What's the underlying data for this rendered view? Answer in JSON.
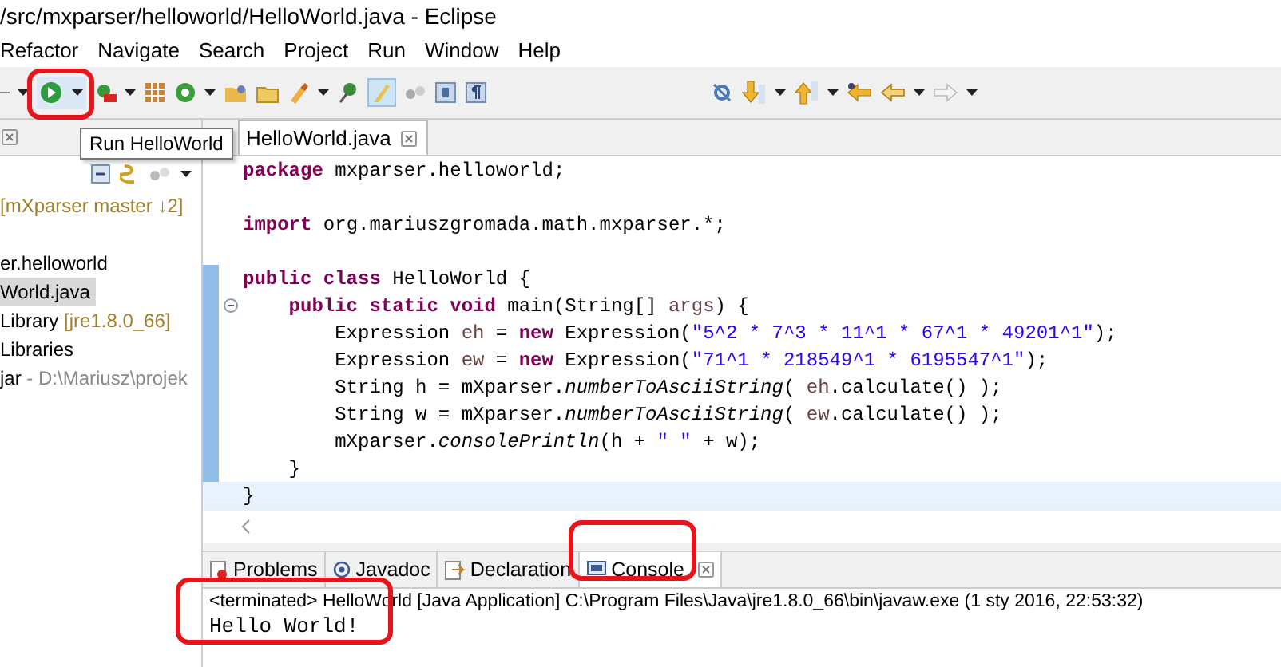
{
  "window": {
    "title": "/src/mxparser/helloworld/HelloWorld.java - Eclipse"
  },
  "menu": [
    "Refactor",
    "Navigate",
    "Search",
    "Project",
    "Run",
    "Window",
    "Help"
  ],
  "tooltip": "Run HelloWorld",
  "explorer": {
    "items": [
      {
        "label": "[mXparser master ↓2]",
        "kind": "decoration",
        "selected": false
      },
      {
        "label": "er.helloworld",
        "kind": "package",
        "selected": false
      },
      {
        "label": "World.java",
        "kind": "file",
        "selected": true
      },
      {
        "label": "Library",
        "decoration": " [jre1.8.0_66]",
        "kind": "library",
        "selected": false
      },
      {
        "label": "Libraries",
        "kind": "library",
        "selected": false
      },
      {
        "label": "jar",
        "decoration": " - D:\\Mariusz\\projek",
        "kind": "jar",
        "selected": false
      }
    ]
  },
  "editor": {
    "tab": {
      "label": "HelloWorld.java",
      "selected": true
    },
    "lines": [
      {
        "tokens": [
          {
            "t": "package",
            "kind": "keyword"
          },
          {
            "t": " mxparser.helloworld;",
            "kind": "plain"
          }
        ],
        "range": false,
        "current": false
      },
      {
        "range": false,
        "current": false
      },
      {
        "tokens": [
          {
            "t": "import",
            "kind": "keyword"
          },
          {
            "t": " org.mariuszgromada.math.mxparser.*;",
            "kind": "plain"
          }
        ],
        "range": false,
        "current": false
      },
      {
        "range": false,
        "current": false
      },
      {
        "tokens": [
          {
            "t": "public class",
            "kind": "keyword"
          },
          {
            "t": " HelloWorld {",
            "kind": "plain"
          }
        ],
        "range": true,
        "current": false
      },
      {
        "tokens": [
          {
            "t": "    public static void",
            "kind": "keyword"
          },
          {
            "t": " main(String[] ",
            "kind": "plain"
          },
          {
            "t": "args",
            "kind": "local"
          },
          {
            "t": ") {",
            "kind": "plain"
          }
        ],
        "range": true,
        "current": false,
        "foldable": true
      },
      {
        "tokens": [
          {
            "t": "        Expression ",
            "kind": "plain"
          },
          {
            "t": "eh",
            "kind": "local"
          },
          {
            "t": " = ",
            "kind": "plain"
          },
          {
            "t": "new",
            "kind": "keyword"
          },
          {
            "t": " Expression(",
            "kind": "plain"
          },
          {
            "t": "\"5^2 * 7^3 * 11^1 * 67^1 * 49201^1\"",
            "kind": "string"
          },
          {
            "t": ");",
            "kind": "plain"
          }
        ],
        "range": true,
        "current": false
      },
      {
        "tokens": [
          {
            "t": "        Expression ",
            "kind": "plain"
          },
          {
            "t": "ew",
            "kind": "local"
          },
          {
            "t": " = ",
            "kind": "plain"
          },
          {
            "t": "new",
            "kind": "keyword"
          },
          {
            "t": " Expression(",
            "kind": "plain"
          },
          {
            "t": "\"71^1 * 218549^1 * 6195547^1\"",
            "kind": "string"
          },
          {
            "t": ");",
            "kind": "plain"
          }
        ],
        "range": true,
        "current": false
      },
      {
        "tokens": [
          {
            "t": "        String h = mXparser.",
            "kind": "plain"
          },
          {
            "t": "numberToAsciiString",
            "kind": "static"
          },
          {
            "t": "( ",
            "kind": "plain"
          },
          {
            "t": "eh",
            "kind": "local"
          },
          {
            "t": ".calculate() );",
            "kind": "plain"
          }
        ],
        "range": true,
        "current": false
      },
      {
        "tokens": [
          {
            "t": "        String w = mXparser.",
            "kind": "plain"
          },
          {
            "t": "numberToAsciiString",
            "kind": "static"
          },
          {
            "t": "( ",
            "kind": "plain"
          },
          {
            "t": "ew",
            "kind": "local"
          },
          {
            "t": ".calculate() );",
            "kind": "plain"
          }
        ],
        "range": true,
        "current": false
      },
      {
        "tokens": [
          {
            "t": "        mXparser.",
            "kind": "plain"
          },
          {
            "t": "consolePrintln",
            "kind": "static"
          },
          {
            "t": "(h + ",
            "kind": "plain"
          },
          {
            "t": "\" \"",
            "kind": "string"
          },
          {
            "t": " + w);",
            "kind": "plain"
          }
        ],
        "range": true,
        "current": false
      },
      {
        "tokens": [
          {
            "t": "    }",
            "kind": "plain"
          }
        ],
        "range": true,
        "current": false
      },
      {
        "tokens": [
          {
            "t": "}",
            "kind": "plain"
          }
        ],
        "range": false,
        "current": true
      }
    ]
  },
  "bottom_tabs": [
    {
      "label": "Problems",
      "kind": "problems",
      "selected": false
    },
    {
      "label": "Javadoc",
      "kind": "javadoc",
      "selected": false
    },
    {
      "label": "Declaration",
      "kind": "declaration",
      "selected": false
    },
    {
      "label": "Console",
      "kind": "console",
      "selected": true
    }
  ],
  "console": {
    "header": "<terminated> HelloWorld [Java Application] C:\\Program Files\\Java\\jre1.8.0_66\\bin\\javaw.exe (1 sty 2016, 22:53:32)",
    "output": "Hello World!"
  }
}
